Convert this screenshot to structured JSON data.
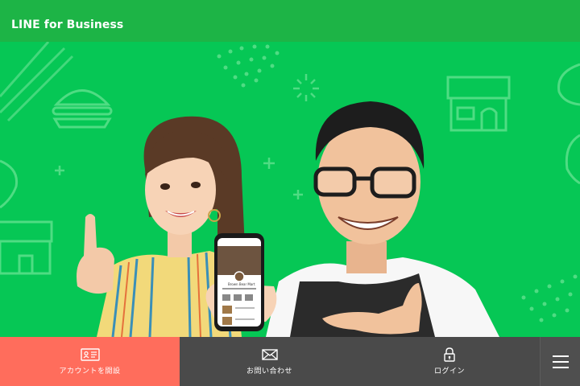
{
  "header": {
    "logo": "LINE for Business"
  },
  "hero": {
    "image": "hero-image-woman-and-man-with-smartphone",
    "phone_screen_title": "Brown Bear Mart"
  },
  "bottom_nav": {
    "items": [
      {
        "label": "アカウントを開設",
        "icon": "id-card-icon"
      },
      {
        "label": "お問い合わせ",
        "icon": "envelope-icon"
      },
      {
        "label": "ログイン",
        "icon": "lock-icon"
      }
    ],
    "menu_icon": "hamburger-menu-icon"
  },
  "colors": {
    "header_bg": "#1db446",
    "hero_bg": "#06c755",
    "primary_cta": "#ff6d5c",
    "nav_bg": "#4a4a4a"
  }
}
